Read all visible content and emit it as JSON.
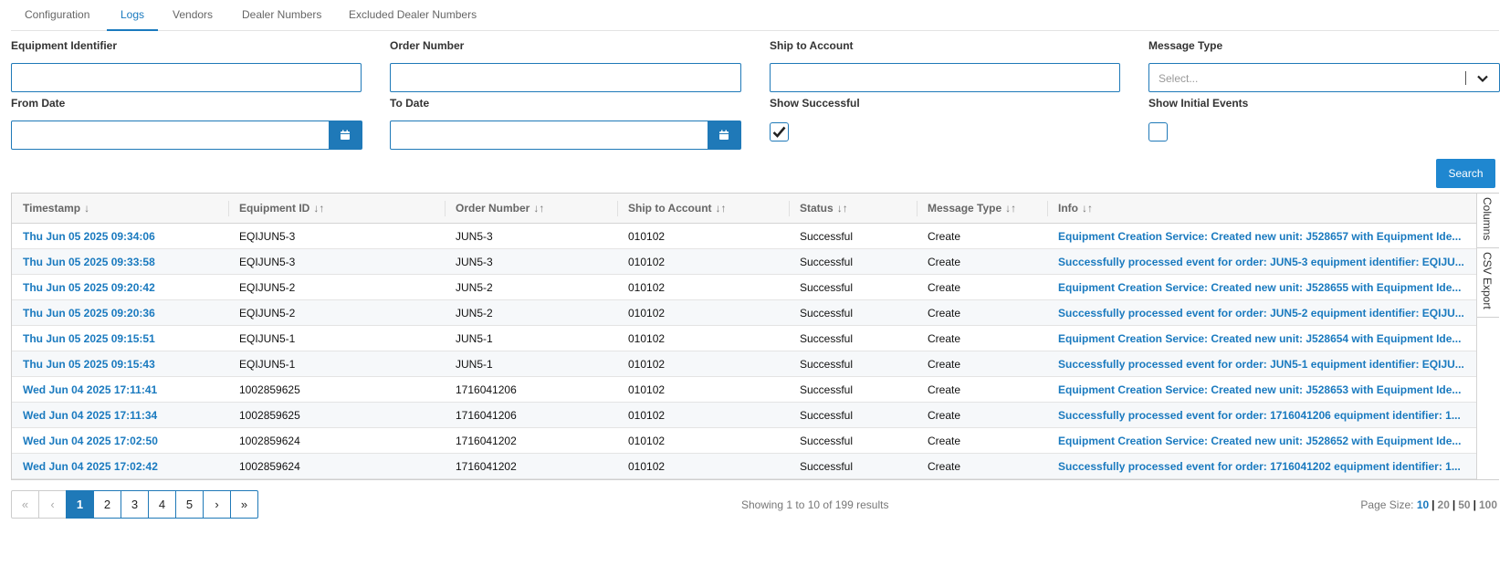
{
  "tabs": [
    {
      "label": "Configuration",
      "active": false
    },
    {
      "label": "Logs",
      "active": true
    },
    {
      "label": "Vendors",
      "active": false
    },
    {
      "label": "Dealer Numbers",
      "active": false
    },
    {
      "label": "Excluded Dealer Numbers",
      "active": false
    }
  ],
  "filters": {
    "equipment_identifier": {
      "label": "Equipment Identifier",
      "value": ""
    },
    "order_number": {
      "label": "Order Number",
      "value": ""
    },
    "ship_to_account": {
      "label": "Ship to Account",
      "value": ""
    },
    "message_type": {
      "label": "Message Type",
      "placeholder": "Select..."
    },
    "from_date": {
      "label": "From Date",
      "value": ""
    },
    "to_date": {
      "label": "To Date",
      "value": ""
    },
    "show_successful": {
      "label": "Show Successful",
      "checked": true
    },
    "show_initial_events": {
      "label": "Show Initial Events",
      "checked": false
    },
    "search_label": "Search"
  },
  "grid": {
    "columns": [
      {
        "label": "Timestamp",
        "sort_icon": "↓"
      },
      {
        "label": "Equipment ID",
        "sort_icon": "↓↑"
      },
      {
        "label": "Order Number",
        "sort_icon": "↓↑"
      },
      {
        "label": "Ship to Account",
        "sort_icon": "↓↑"
      },
      {
        "label": "Status",
        "sort_icon": "↓↑"
      },
      {
        "label": "Message Type",
        "sort_icon": "↓↑"
      },
      {
        "label": "Info",
        "sort_icon": "↓↑"
      }
    ],
    "rows": [
      {
        "timestamp": "Thu Jun 05 2025 09:34:06",
        "equipment_id": "EQIJUN5-3",
        "order_number": "JUN5-3",
        "ship_to": "010102",
        "status": "Successful",
        "message_type": "Create",
        "info": "Equipment Creation Service: Created new unit: J528657 with Equipment Ide..."
      },
      {
        "timestamp": "Thu Jun 05 2025 09:33:58",
        "equipment_id": "EQIJUN5-3",
        "order_number": "JUN5-3",
        "ship_to": "010102",
        "status": "Successful",
        "message_type": "Create",
        "info": "Successfully processed event for order: JUN5-3 equipment identifier: EQIJU..."
      },
      {
        "timestamp": "Thu Jun 05 2025 09:20:42",
        "equipment_id": "EQIJUN5-2",
        "order_number": "JUN5-2",
        "ship_to": "010102",
        "status": "Successful",
        "message_type": "Create",
        "info": "Equipment Creation Service: Created new unit: J528655 with Equipment Ide..."
      },
      {
        "timestamp": "Thu Jun 05 2025 09:20:36",
        "equipment_id": "EQIJUN5-2",
        "order_number": "JUN5-2",
        "ship_to": "010102",
        "status": "Successful",
        "message_type": "Create",
        "info": "Successfully processed event for order: JUN5-2 equipment identifier: EQIJU..."
      },
      {
        "timestamp": "Thu Jun 05 2025 09:15:51",
        "equipment_id": "EQIJUN5-1",
        "order_number": "JUN5-1",
        "ship_to": "010102",
        "status": "Successful",
        "message_type": "Create",
        "info": "Equipment Creation Service: Created new unit: J528654 with Equipment Ide..."
      },
      {
        "timestamp": "Thu Jun 05 2025 09:15:43",
        "equipment_id": "EQIJUN5-1",
        "order_number": "JUN5-1",
        "ship_to": "010102",
        "status": "Successful",
        "message_type": "Create",
        "info": "Successfully processed event for order: JUN5-1 equipment identifier: EQIJU..."
      },
      {
        "timestamp": "Wed Jun 04 2025 17:11:41",
        "equipment_id": "1002859625",
        "order_number": "1716041206",
        "ship_to": "010102",
        "status": "Successful",
        "message_type": "Create",
        "info": "Equipment Creation Service: Created new unit: J528653 with Equipment Ide..."
      },
      {
        "timestamp": "Wed Jun 04 2025 17:11:34",
        "equipment_id": "1002859625",
        "order_number": "1716041206",
        "ship_to": "010102",
        "status": "Successful",
        "message_type": "Create",
        "info": "Successfully processed event for order: 1716041206 equipment identifier: 1..."
      },
      {
        "timestamp": "Wed Jun 04 2025 17:02:50",
        "equipment_id": "1002859624",
        "order_number": "1716041202",
        "ship_to": "010102",
        "status": "Successful",
        "message_type": "Create",
        "info": "Equipment Creation Service: Created new unit: J528652 with Equipment Ide..."
      },
      {
        "timestamp": "Wed Jun 04 2025 17:02:42",
        "equipment_id": "1002859624",
        "order_number": "1716041202",
        "ship_to": "010102",
        "status": "Successful",
        "message_type": "Create",
        "info": "Successfully processed event for order: 1716041202 equipment identifier: 1..."
      }
    ],
    "side_tabs": [
      "Columns",
      "CSV Export"
    ]
  },
  "pagination": {
    "first": "«",
    "prev": "‹",
    "pages": [
      "1",
      "2",
      "3",
      "4",
      "5"
    ],
    "current_page": "1",
    "next": "›",
    "last": "»",
    "showing_text": "Showing 1 to 10 of 199 results",
    "page_size_label": "Page Size:",
    "page_sizes": [
      "10",
      "20",
      "50",
      "100"
    ],
    "current_page_size": "10"
  },
  "colors": {
    "accent": "#1f79b8",
    "link": "#1a7abf"
  }
}
